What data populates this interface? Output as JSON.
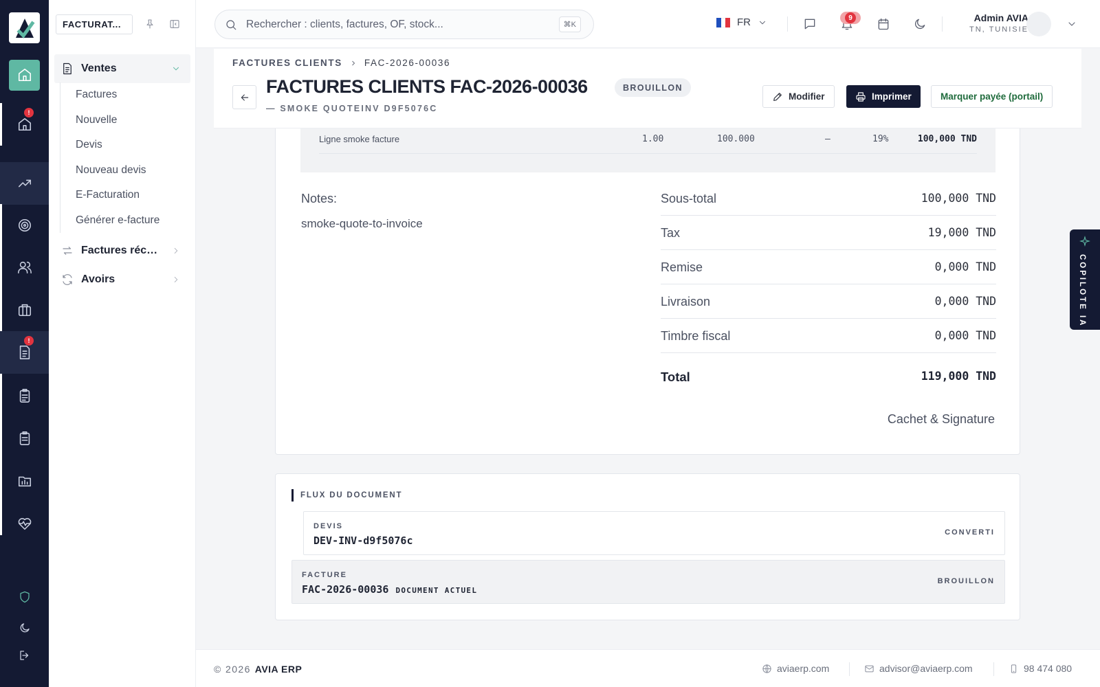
{
  "app": {
    "module_label": "FACTURAT...",
    "brand": "AVIA ERP"
  },
  "search": {
    "placeholder": "Rechercher : clients, factures, OF, stock...",
    "shortcut": "⌘K"
  },
  "topbar": {
    "language": "FR",
    "notifications_count": "9",
    "user_name": "Admin AVIA",
    "user_location": "TN, TUNISIE"
  },
  "rail": {
    "badges": [
      "!",
      "!"
    ]
  },
  "sidebar": {
    "groups": [
      {
        "label": "Ventes",
        "icon": "document-icon",
        "expanded": true
      },
      {
        "label": "Factures récu...",
        "icon": "exchange-icon",
        "expanded": false
      },
      {
        "label": "Avoirs",
        "icon": "refresh-icon",
        "expanded": false
      }
    ],
    "ventes_items": [
      "Factures",
      "Nouvelle",
      "Devis",
      "Nouveau devis",
      "E-Facturation",
      "Générer e-facture"
    ]
  },
  "page": {
    "breadcrumb_parent": "FACTURES CLIENTS",
    "breadcrumb_current": "FAC-2026-00036",
    "title": "FACTURES CLIENTS FAC-2026-00036",
    "status_badge": "BROUILLON",
    "subtitle": "— SMOKE QUOTEINV D9F5076C",
    "actions": {
      "edit": "Modifier",
      "print": "Imprimer",
      "mark_paid": "Marquer payée (portail)"
    }
  },
  "invoice": {
    "line": {
      "description": "Ligne smoke facture",
      "quantity": "1.00",
      "unit_price": "100.000",
      "discount": "—",
      "tax_rate": "19%",
      "total": "100,000 TND"
    },
    "notes_label": "Notes:",
    "notes_value": "smoke-quote-to-invoice",
    "totals": [
      {
        "label": "Sous-total",
        "value": "100,000 TND"
      },
      {
        "label": "Tax",
        "value": "19,000 TND"
      },
      {
        "label": "Remise",
        "value": "0,000 TND"
      },
      {
        "label": "Livraison",
        "value": "0,000 TND"
      },
      {
        "label": "Timbre fiscal",
        "value": "0,000 TND"
      }
    ],
    "grand_total_label": "Total",
    "grand_total_value": "119,000 TND",
    "signature_label": "Cachet & Signature"
  },
  "flow": {
    "title": "FLUX DU DOCUMENT",
    "steps": [
      {
        "type": "DEVIS",
        "id": "DEV-INV-d9f5076c",
        "status": "CONVERTI",
        "current_tag": ""
      },
      {
        "type": "FACTURE",
        "id": "FAC-2026-00036",
        "status": "BROUILLON",
        "current_tag": "DOCUMENT ACTUEL"
      }
    ]
  },
  "footer": {
    "copyright": "© 2026",
    "brand": "AVIA ERP",
    "website": "aviaerp.com",
    "email": "advisor@aviaerp.com",
    "phone": "98 474 080"
  },
  "copilot": {
    "label": "COPILOTE IA"
  }
}
